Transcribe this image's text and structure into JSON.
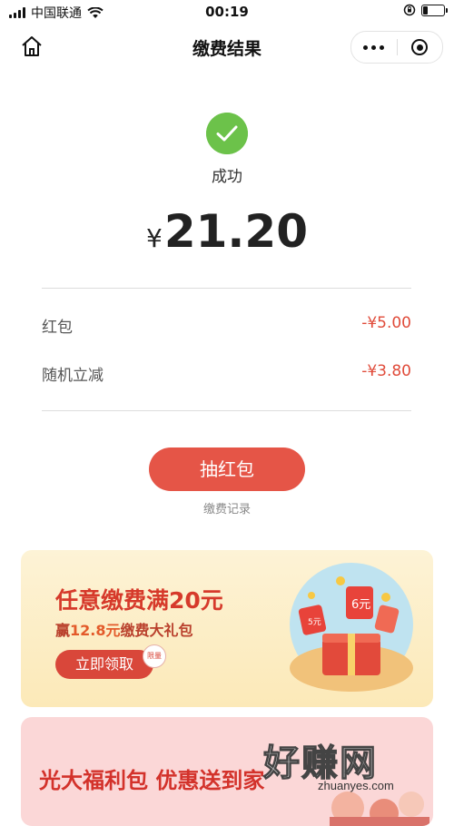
{
  "status_bar": {
    "carrier": "中国联通",
    "time": "00:19"
  },
  "nav": {
    "title": "缴费结果"
  },
  "result": {
    "status_label": "成功",
    "currency": "¥",
    "amount": "21.20",
    "success_color": "#6cc24a"
  },
  "discounts": [
    {
      "label": "红包",
      "value": "-¥5.00"
    },
    {
      "label": "随机立减",
      "value": "-¥3.80"
    }
  ],
  "actions": {
    "draw_button": "抽红包",
    "record_link": "缴费记录",
    "accent_color": "#e55547"
  },
  "banner1": {
    "title": "任意缴费满20元",
    "sub_prefix": "赢",
    "sub_amount": "12.8元",
    "sub_suffix": "缴费大礼包",
    "button": "立即领取",
    "badge": "限量",
    "art_labels": [
      "5元",
      "6元"
    ]
  },
  "banner2": {
    "title": "光大福利包 优惠送到家"
  },
  "watermark": {
    "text": "好赚网",
    "url": "zhuanyes.com"
  }
}
